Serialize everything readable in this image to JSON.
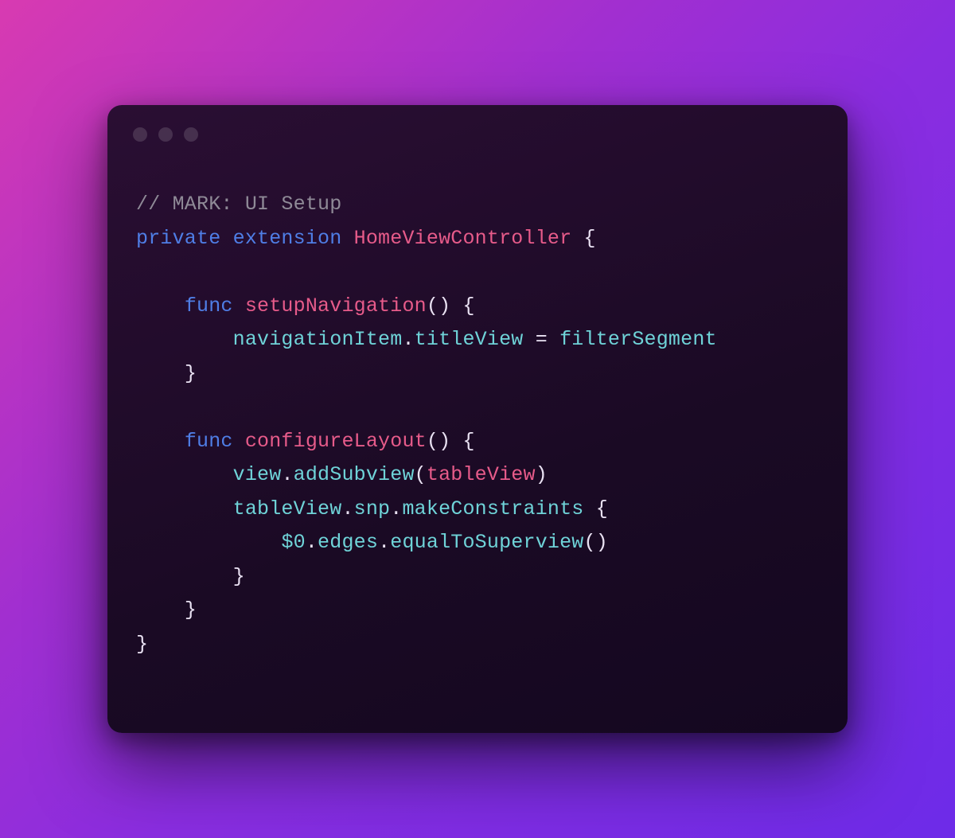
{
  "code": {
    "line1_comment": "// MARK: UI Setup",
    "line2_private": "private",
    "line2_extension": "extension",
    "line2_type": "HomeViewController",
    "line2_brace": " {",
    "line4_func": "func",
    "line4_name": "setupNavigation",
    "line4_paren_brace": "() {",
    "line5_nav": "navigationItem",
    "line5_dot1": ".",
    "line5_title": "titleView",
    "line5_eq": " = ",
    "line5_filter": "filterSegment",
    "line6_close": "}",
    "line8_func": "func",
    "line8_name": "configureLayout",
    "line8_paren_brace": "() {",
    "line9_view": "view",
    "line9_dot1": ".",
    "line9_add": "addSubview",
    "line9_open": "(",
    "line9_tv": "tableView",
    "line9_close": ")",
    "line10_tv": "tableView",
    "line10_dot1": ".",
    "line10_snp": "snp",
    "line10_dot2": ".",
    "line10_make": "makeConstraints",
    "line10_brace": " {",
    "line11_dollar": "$0",
    "line11_dot1": ".",
    "line11_edges": "edges",
    "line11_dot2": ".",
    "line11_equal": "equalToSuperview",
    "line11_paren": "()",
    "line12_close": "}",
    "line13_close": "}",
    "line14_close": "}"
  }
}
